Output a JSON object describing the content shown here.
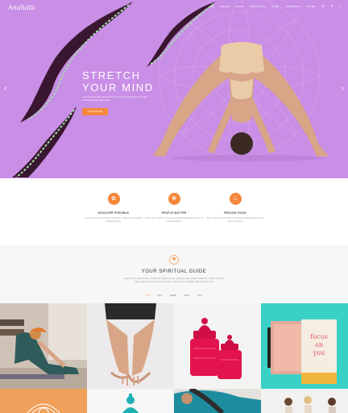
{
  "header": {
    "logo": "Anahata",
    "nav": [
      "HOME",
      "PAGES",
      "BLOG",
      "PORTFOLIO",
      "SHOP",
      "ELEMENTS",
      "STORE"
    ]
  },
  "hero": {
    "title_line1": "STRETCH",
    "title_line2": "YOUR MIND",
    "subtitle": "Lorem ipsum dolor sit amet, sed do eiusmod tempor. Aenean commodo ligula eget dolor.",
    "button_label": "VIEW MORE",
    "prev_arrow": "‹",
    "next_arrow": "›",
    "background": "#c98ee6",
    "accent": "#f5873b"
  },
  "features": [
    {
      "icon": "lotus-icon",
      "glyph": "✿",
      "title": "DISCOVER POSSIBLE",
      "text": "Lorem ipsum dolor sit amet, consectetur adipiscing elit, sed do eiusmod tempor."
    },
    {
      "icon": "meditation-icon",
      "glyph": "☸",
      "title": "PEOPLE MATTER",
      "text": "Lorem ipsum dolor sit amet, consectetur adipiscing elit, sed do eiusmod tempor."
    },
    {
      "icon": "yoga-pose-icon",
      "glyph": "♨",
      "title": "FEELING GOOD",
      "text": "Lorem ipsum dolor sit amet, consectetur adipiscing elit, sed do eiusmod tempor."
    }
  ],
  "guide": {
    "icon_glyph": "✺",
    "title": "YOUR SPIRITUAL GUIDE",
    "text": "Lorem ipsum dolor sit amet, consectetur adipiscing elit, sed do eiusmod tempor incididunt ut labore et dolore magna aliqua. Ut enim ad minim veniam, quis nostrud exercitation ullamco laboris nisi.",
    "filters": [
      "All",
      "Yoga",
      "Health",
      "Mind",
      "Soul"
    ],
    "active_filter": "All"
  },
  "gallery": [
    "yoga-stretch-photo",
    "hands-pose-photo",
    "pink-jars-photo",
    "notebooks-photo",
    "mandala-orange-tile",
    "buddha-statue-tile",
    "yoga-mat-photo",
    "group-class-photo"
  ]
}
